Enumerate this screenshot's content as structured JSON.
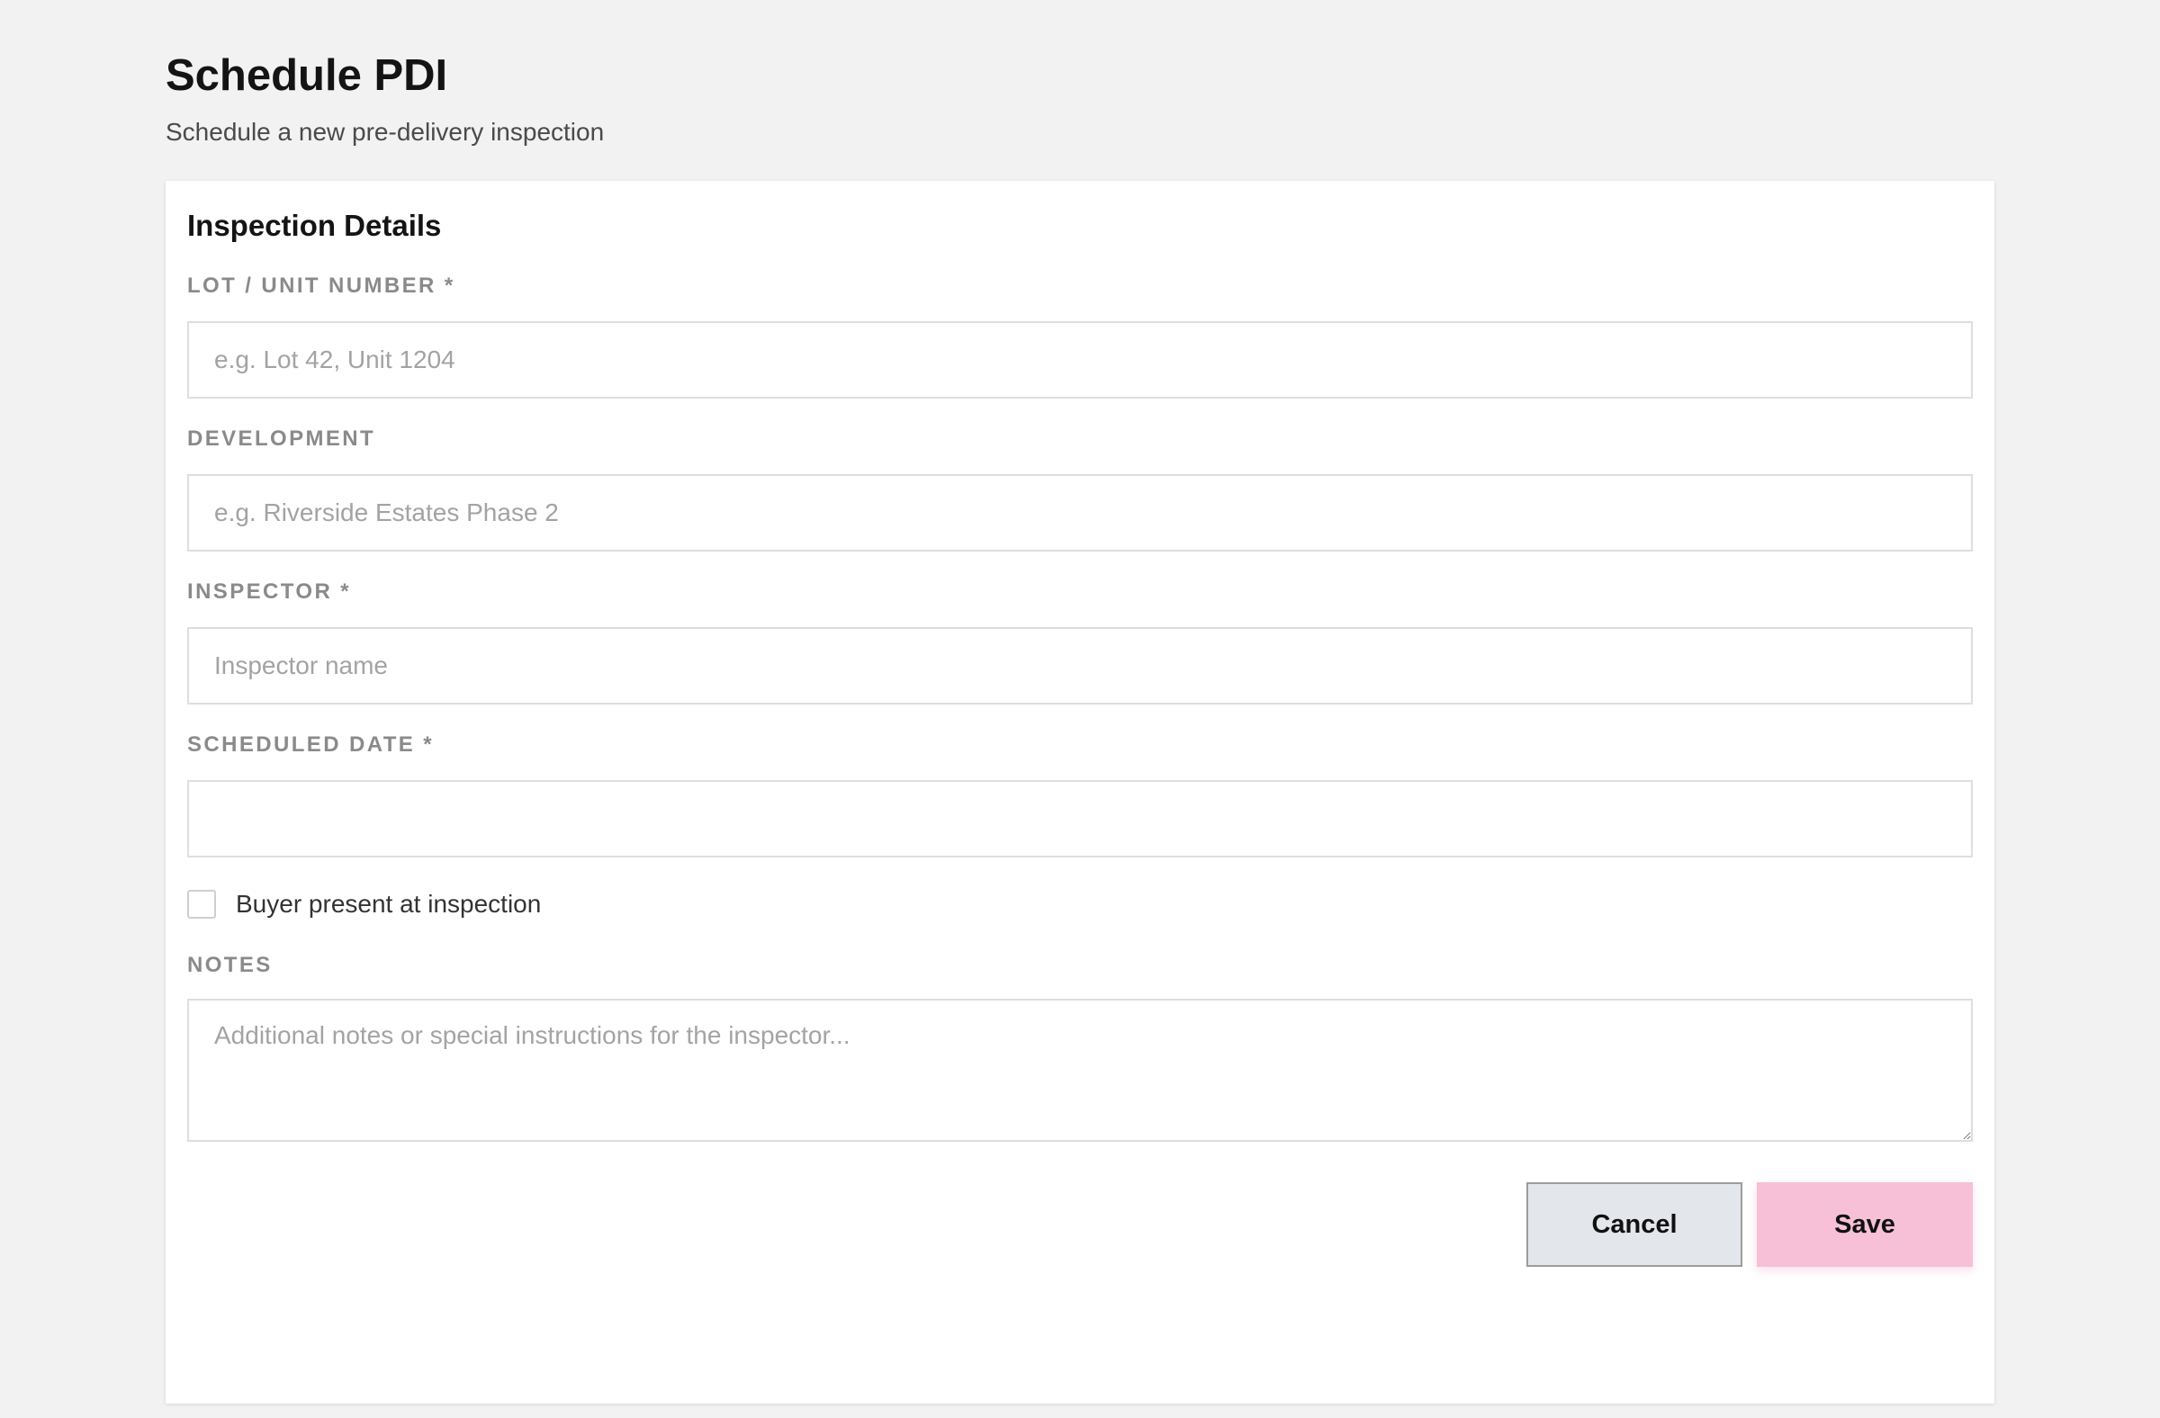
{
  "header": {
    "title": "Schedule PDI",
    "subtitle": "Schedule a new pre-delivery inspection"
  },
  "card": {
    "title": "Inspection Details"
  },
  "fields": {
    "lot": {
      "label": "LOT / UNIT NUMBER *",
      "placeholder": "e.g. Lot 42, Unit 1204",
      "value": ""
    },
    "development": {
      "label": "DEVELOPMENT",
      "placeholder": "e.g. Riverside Estates Phase 2",
      "value": ""
    },
    "inspector": {
      "label": "INSPECTOR *",
      "placeholder": "Inspector name",
      "value": ""
    },
    "scheduled_date": {
      "label": "SCHEDULED DATE *",
      "value": ""
    },
    "buyer_present": {
      "label": "Buyer present at inspection",
      "checked": false
    },
    "notes": {
      "label": "NOTES",
      "placeholder": "Additional notes or special instructions for the inspector...",
      "value": ""
    }
  },
  "actions": {
    "cancel_label": "Cancel",
    "save_label": "Save"
  },
  "colors": {
    "page_background": "#f2f2f2",
    "card_background": "#ffffff",
    "save_button": "#f7c0d7",
    "cancel_button": "#e3e6ea",
    "label_gray": "#8a8a8a"
  }
}
